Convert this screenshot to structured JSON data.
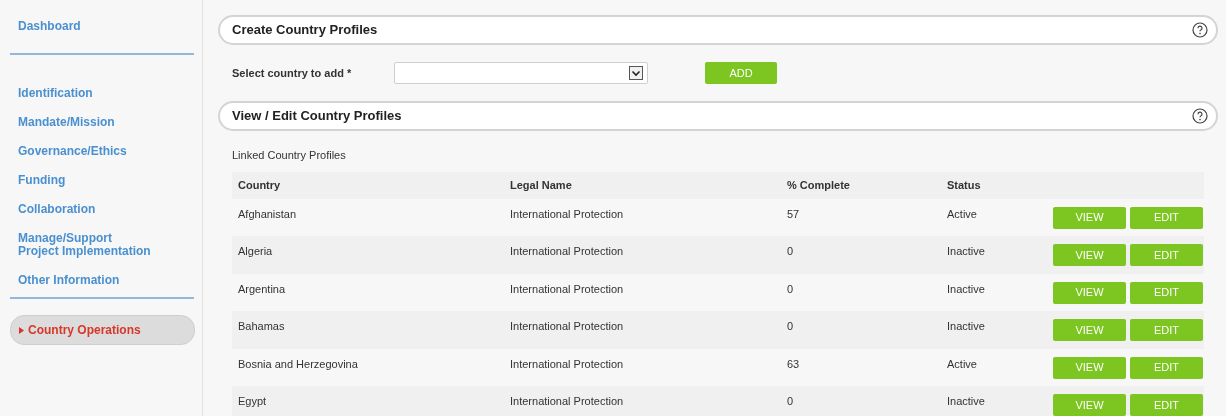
{
  "sidebar": {
    "groups": [
      [
        {
          "label": "Dashboard",
          "selected": false
        }
      ],
      [
        {
          "label": "Identification",
          "selected": false
        },
        {
          "label": "Mandate/Mission",
          "selected": false
        },
        {
          "label": "Governance/Ethics",
          "selected": false
        },
        {
          "label": "Funding",
          "selected": false
        },
        {
          "label": "Collaboration",
          "selected": false
        },
        {
          "label": "Manage/Support\nProject Implementation",
          "selected": false
        },
        {
          "label": "Other Information",
          "selected": false
        }
      ],
      [
        {
          "label": "Country Operations",
          "selected": true
        }
      ]
    ]
  },
  "create_section": {
    "title": "Create Country Profiles",
    "select_label": "Select country to add *",
    "add_button": "ADD"
  },
  "view_section": {
    "title": "View / Edit Country Profiles",
    "caption": "Linked Country Profiles",
    "table": {
      "columns": [
        "Country",
        "Legal Name",
        "% Complete",
        "Status"
      ],
      "rows": [
        {
          "country": "Afghanistan",
          "legal_name": "International Protection",
          "complete": "57",
          "status": "Active",
          "actions": [
            "VIEW",
            "EDIT"
          ]
        },
        {
          "country": "Algeria",
          "legal_name": "International Protection",
          "complete": "0",
          "status": "Inactive",
          "actions": [
            "VIEW",
            "EDIT"
          ]
        },
        {
          "country": "Argentina",
          "legal_name": "International Protection",
          "complete": "0",
          "status": "Inactive",
          "actions": [
            "VIEW",
            "EDIT"
          ]
        },
        {
          "country": "Bahamas",
          "legal_name": "International Protection",
          "complete": "0",
          "status": "Inactive",
          "actions": [
            "VIEW",
            "EDIT"
          ]
        },
        {
          "country": "Bosnia and Herzegovina",
          "legal_name": "International Protection",
          "complete": "63",
          "status": "Active",
          "actions": [
            "VIEW",
            "EDIT"
          ]
        },
        {
          "country": "Egypt",
          "legal_name": "International Protection",
          "complete": "0",
          "status": "Inactive",
          "actions": [
            "VIEW",
            "EDIT"
          ]
        }
      ]
    }
  }
}
